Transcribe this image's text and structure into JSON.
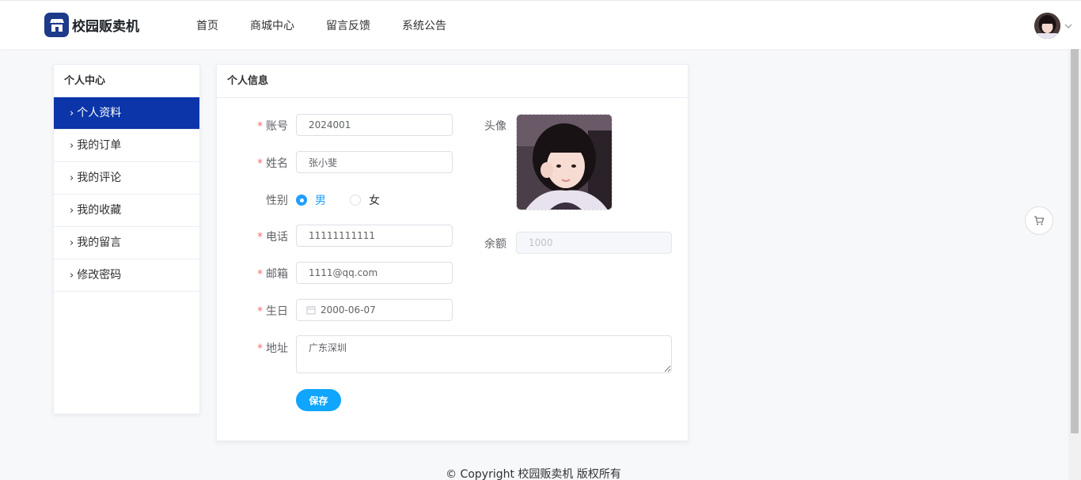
{
  "header": {
    "logo_text": "校园贩卖机",
    "nav": [
      "首页",
      "商城中心",
      "留言反馈",
      "系统公告"
    ]
  },
  "sidebar": {
    "title": "个人中心",
    "items": [
      "个人资料",
      "我的订单",
      "我的评论",
      "我的收藏",
      "我的留言",
      "修改密码"
    ],
    "active_index": 0
  },
  "card": {
    "title": "个人信息",
    "fields": {
      "account": {
        "label": "账号",
        "value": "2024001"
      },
      "name": {
        "label": "姓名",
        "value": "张小斐"
      },
      "gender": {
        "label": "性别",
        "options": [
          "男",
          "女"
        ],
        "selected": "男"
      },
      "phone": {
        "label": "电话",
        "value": "11111111111"
      },
      "email": {
        "label": "邮箱",
        "value": "1111@qq.com"
      },
      "birthday": {
        "label": "生日",
        "value": "2000-06-07"
      },
      "address": {
        "label": "地址",
        "value": "广东深圳"
      },
      "avatar": {
        "label": "头像"
      },
      "balance": {
        "label": "余额",
        "value": "1000"
      }
    },
    "save_label": "保存"
  },
  "footer": {
    "text": "© Copyright 校园贩卖机 版权所有"
  },
  "colors": {
    "primary": "#0b35a8",
    "accent": "#10a5ff",
    "required": "#f56c6c"
  }
}
